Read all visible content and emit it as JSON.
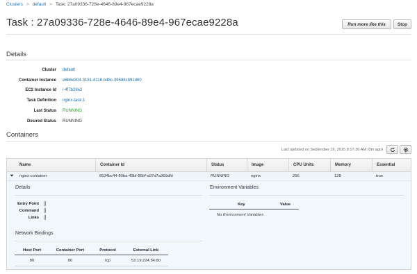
{
  "breadcrumb": {
    "clusters": "Clusters",
    "default": "default",
    "current": "Task: 27a09336-728e-4646-89e4-967ecae9228a"
  },
  "header": {
    "title": "Task : 27a09336-728e-4646-89e4-967ecae9228a",
    "run_more_label": "Run more like this",
    "stop_label": "Stop"
  },
  "details": {
    "heading": "Details",
    "rows": [
      {
        "label": "Cluster",
        "value": "default"
      },
      {
        "label": "Container Instance",
        "value": "e6b6e304-3181-4118-b48c-39586c891d60"
      },
      {
        "label": "EC2 Instance Id",
        "value": "i-4f7b28e2"
      },
      {
        "label": "Task Definition",
        "value": "nginx-task:1"
      },
      {
        "label": "Last Status",
        "value": "RUNNING"
      },
      {
        "label": "Desired Status",
        "value": "RUNNING"
      }
    ]
  },
  "containers": {
    "heading": "Containers",
    "last_updated": "Last updated on September 16, 2015 8:17:36 AM (0m ago)",
    "refresh_icon": "refresh-icon",
    "settings_icon": "gear-icon",
    "columns": [
      "Name",
      "Container Id",
      "Status",
      "Image",
      "CPU Units",
      "Memory",
      "Essential"
    ],
    "rows": [
      {
        "name": "nginx-container",
        "container_id": "8534bc44-80ba-49bf-85bf-a97d7a369dfd",
        "status": "RUNNING",
        "image": "nginx",
        "cpu_units": "256",
        "memory": "128",
        "essential": "true"
      }
    ],
    "expanded": {
      "details_heading": "Details",
      "entry_point_label": "Entry Point",
      "entry_point_value": "[]",
      "command_label": "Command",
      "command_value": "[]",
      "links_label": "Links",
      "links_value": "[]",
      "env_heading": "Environment Variables",
      "env_columns": [
        "Key",
        "Value"
      ],
      "env_empty": "No Environment Variables",
      "network_heading": "Network Bindings",
      "network_columns": [
        "Host Port",
        "Container Port",
        "Protocol",
        "External Link"
      ],
      "network_rows": [
        {
          "host_port": "80",
          "container_port": "80",
          "protocol": "tcp",
          "external_link": "52.19.224.54:80"
        }
      ]
    }
  },
  "colors": {
    "link": "#1f6ea8",
    "running": "#2a9a2a",
    "expanded_bg": "#f1f7fc"
  }
}
